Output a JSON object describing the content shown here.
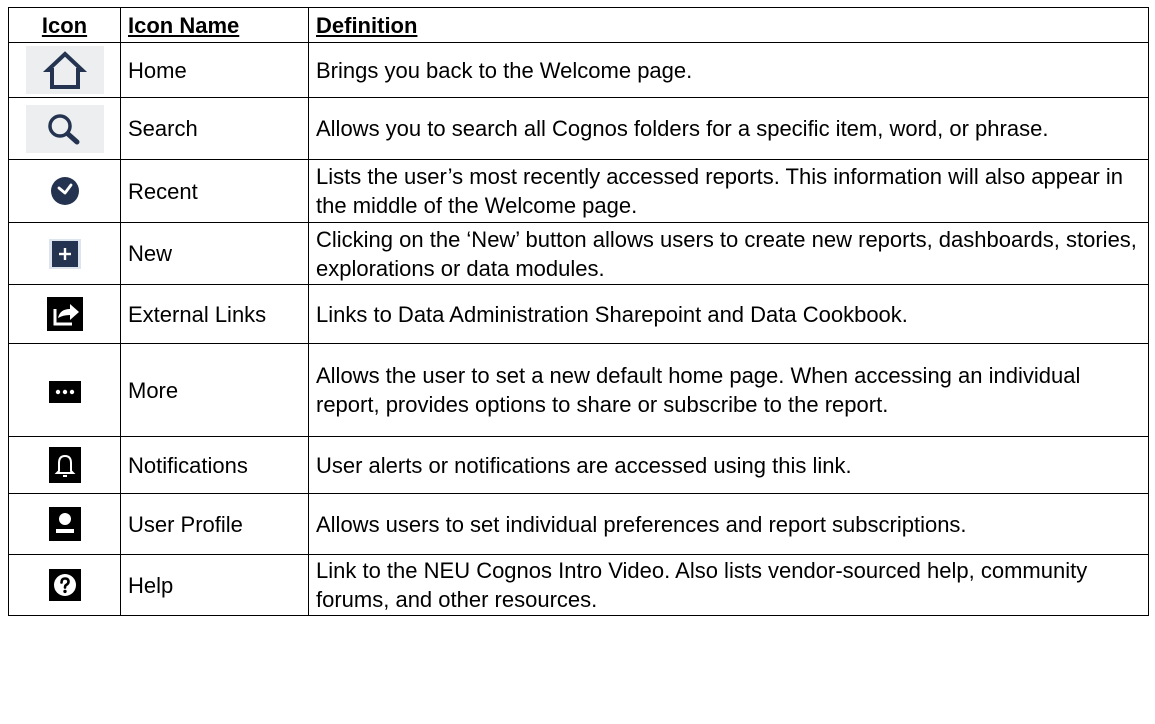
{
  "headers": {
    "icon": "Icon",
    "name": "Icon Name",
    "definition": "Definition"
  },
  "rows": [
    {
      "icon": "home-icon",
      "name": "Home",
      "definition": "Brings you back to the Welcome page."
    },
    {
      "icon": "search-icon",
      "name": "Search",
      "definition": "Allows you to search all Cognos folders for a specific item, word, or phrase."
    },
    {
      "icon": "clock-icon",
      "name": "Recent",
      "definition": "Lists the user’s most recently accessed reports. This information will also appear in the middle of the Welcome page."
    },
    {
      "icon": "plus-icon",
      "name": "New",
      "definition": "Clicking on the ‘New’ button allows users to create new reports, dashboards, stories, explorations or data modules."
    },
    {
      "icon": "external-link-icon",
      "name": "External Links",
      "definition": "Links to Data Administration Sharepoint and Data Cookbook."
    },
    {
      "icon": "more-icon",
      "name": "More",
      "definition": "Allows the user to set a new default home page. When accessing an individual report, provides options to share or subscribe to the report."
    },
    {
      "icon": "bell-icon",
      "name": "Notifications",
      "definition": "User alerts or notifications are accessed using this link."
    },
    {
      "icon": "user-icon",
      "name": "User Profile",
      "definition": "Allows users to set individual preferences and report subscriptions."
    },
    {
      "icon": "help-icon",
      "name": "Help",
      "definition": "Link to the NEU Cognos Intro Video. Also lists vendor-sourced help, community forums, and other resources."
    }
  ],
  "colors": {
    "icon_navy": "#243450",
    "icon_black": "#000000",
    "icon_bg_light": "#eceef0"
  }
}
